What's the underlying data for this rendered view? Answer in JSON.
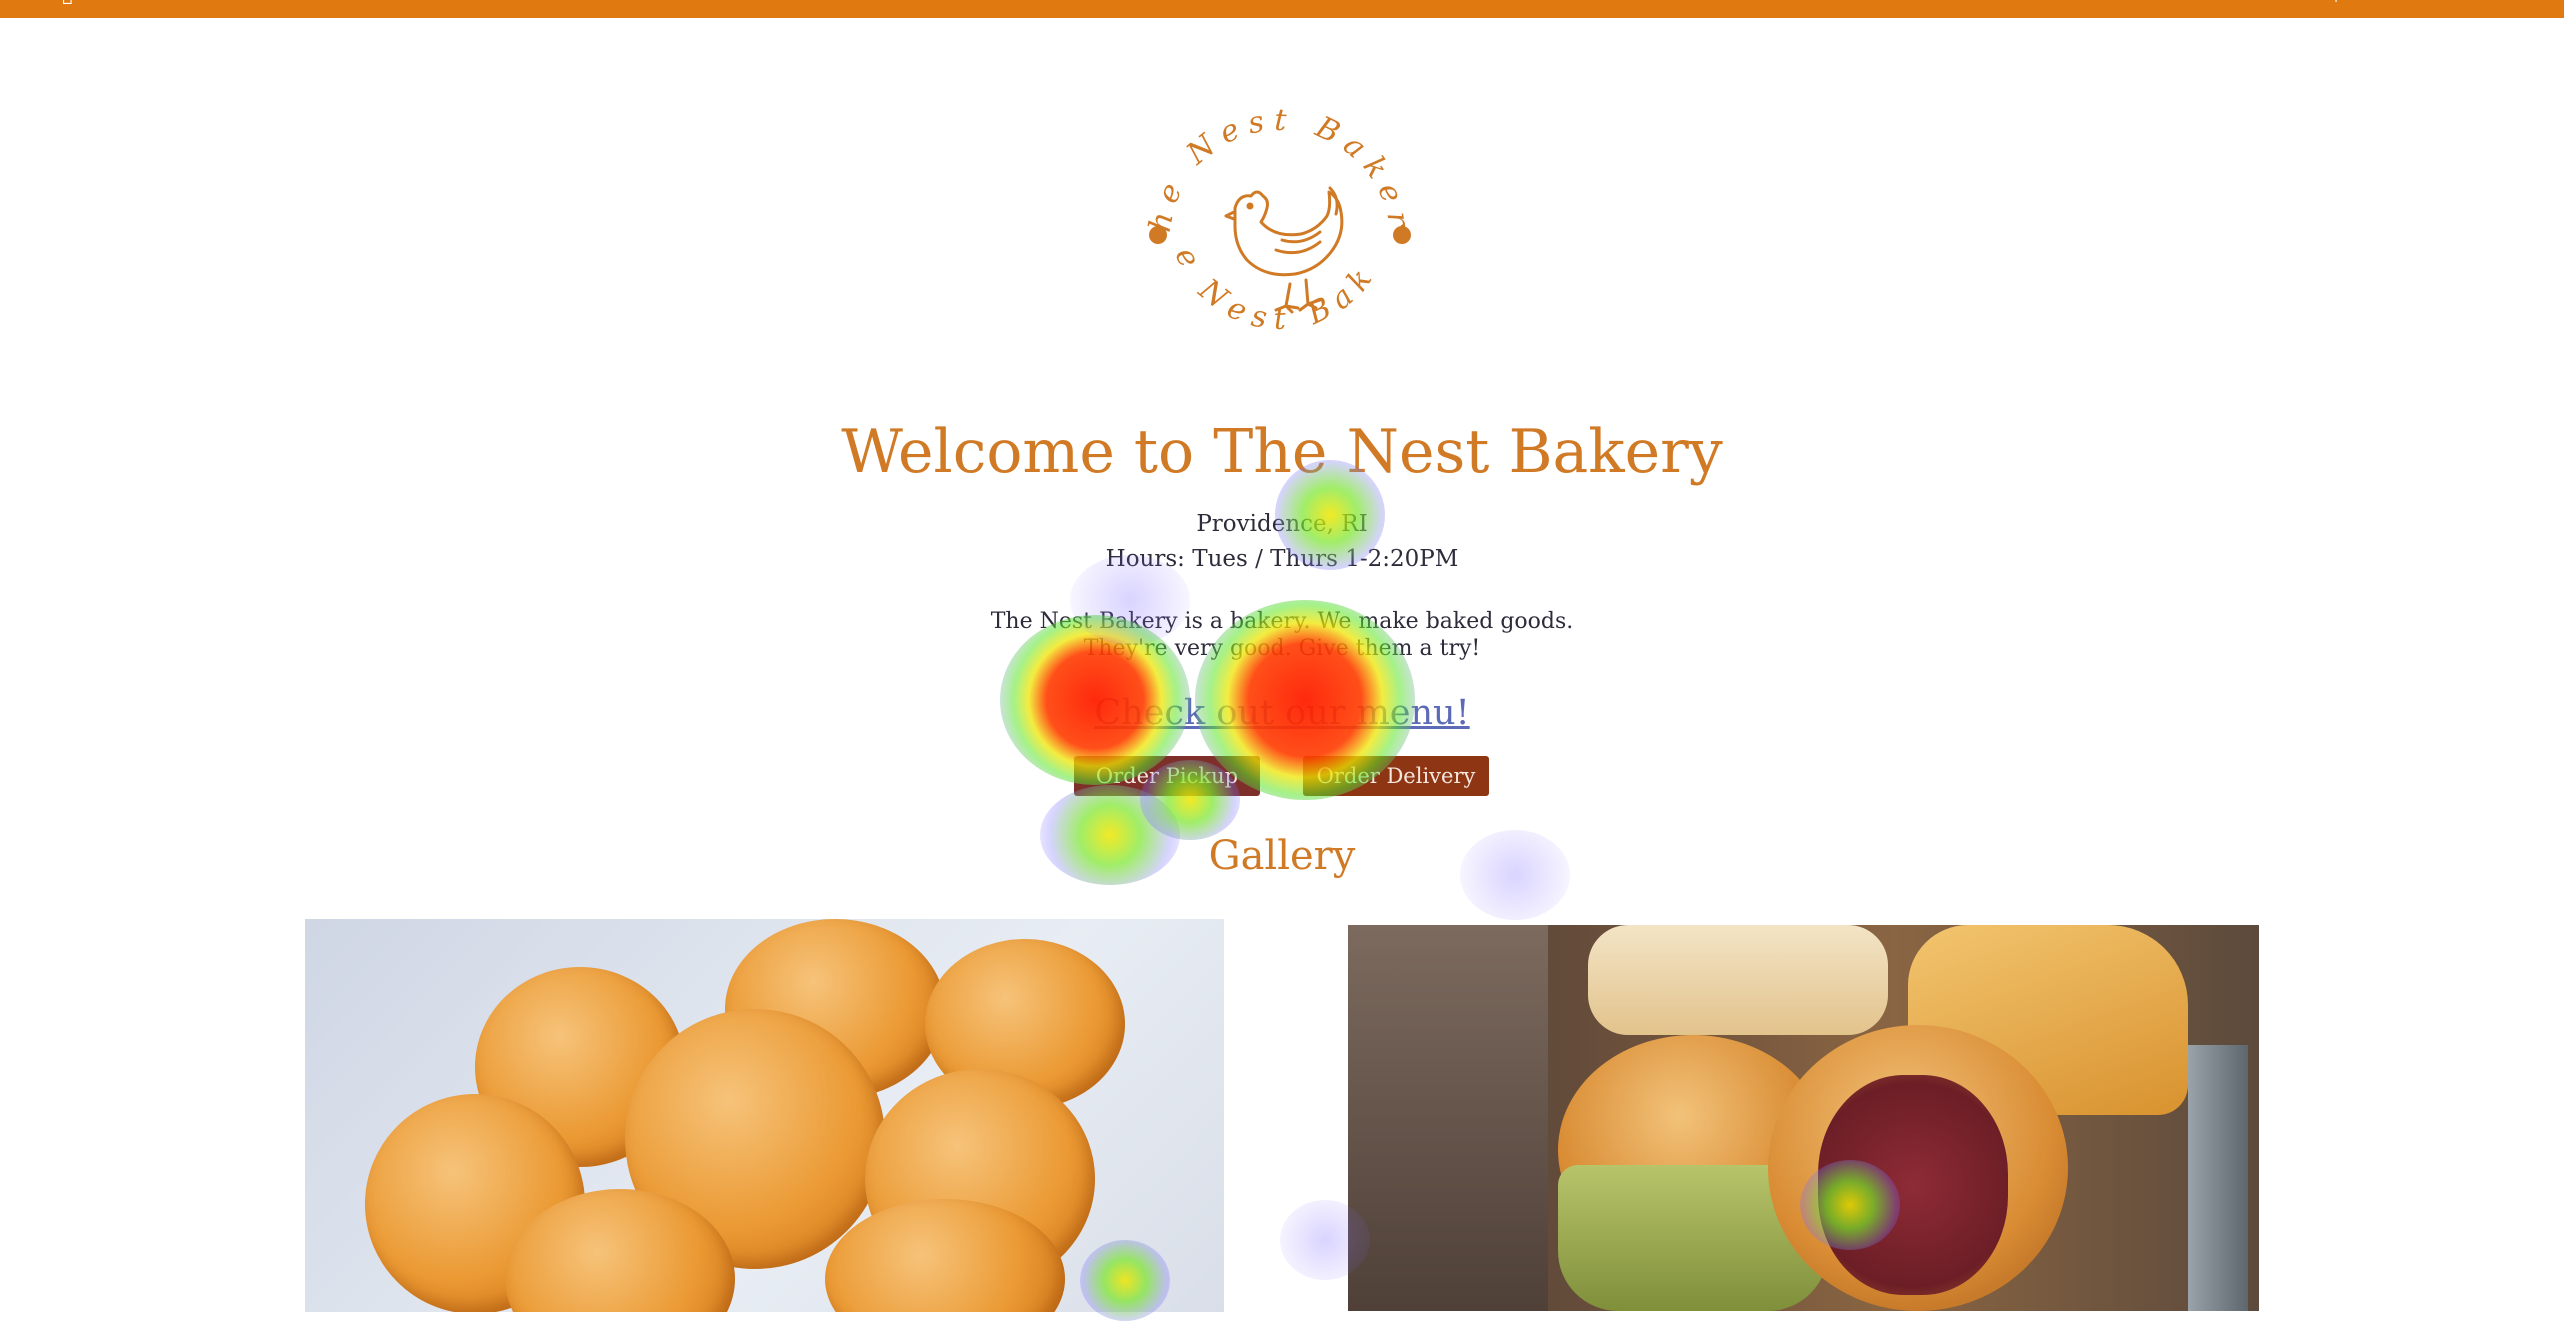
{
  "header": {
    "bar_color": "#e07a10",
    "left_icon": "home-icon",
    "right_icon": "cart-icon"
  },
  "logo": {
    "top_text": "The Nest Bakery",
    "bottom_text": "The Nest Bakery",
    "image": "hen-illustration"
  },
  "hero": {
    "title": "Welcome to The Nest Bakery",
    "location": "Providence, RI",
    "hours": "Hours: Tues / Thurs 1-2:20PM",
    "description_line1": "The Nest Bakery is a bakery. We make baked goods.",
    "description_line2": "They're very good. Give them a try!",
    "menu_link": "Check out our menu!"
  },
  "buttons": {
    "pickup": "Order Pickup",
    "delivery": "Order Delivery"
  },
  "gallery": {
    "title": "Gallery",
    "photos": [
      {
        "subject": "sesame balls"
      },
      {
        "subject": "assorted pastries and buns"
      }
    ]
  },
  "colors": {
    "accent": "#d07a26",
    "text": "#2e2b3a",
    "link": "#5d6ab7",
    "pickup_button": "#7e2f2a",
    "delivery_button": "#8e3514"
  }
}
